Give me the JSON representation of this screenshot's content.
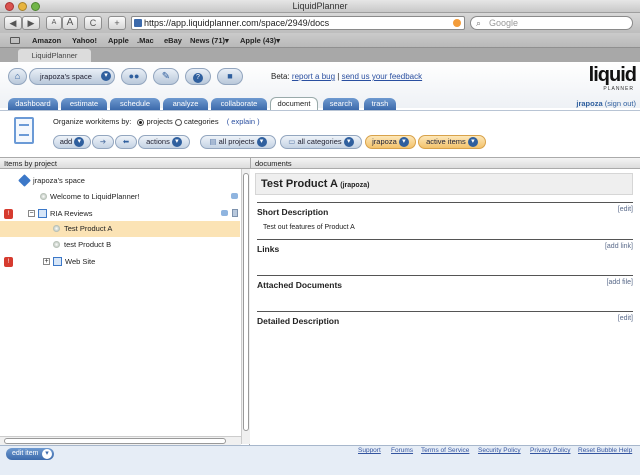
{
  "browser": {
    "window_title": "LiquidPlanner",
    "back_label": "◀",
    "forward_label": "▶",
    "text_smaller": "A",
    "text_larger": "A",
    "reload_label": "C",
    "add_label": "+",
    "url": "https://app.liquidplanner.com/space/2949/docs",
    "search_placeholder": "Google",
    "bookmarks": [
      "Amazon",
      "Yahoo!",
      "Apple",
      ".Mac",
      "eBay",
      "News (71)▾",
      "Apple (43)▾"
    ],
    "tab_title": "LiquidPlanner"
  },
  "app": {
    "space_label": "jrapoza's space",
    "beta_prefix": "Beta:",
    "report_bug": "report a bug",
    "separator": "|",
    "send_feedback": "send us your feedback",
    "logo_text": "liquid",
    "logo_sub": "PLANNER",
    "tabs": [
      "dashboard",
      "estimate",
      "schedule",
      "analyze",
      "collaborate",
      "document",
      "search",
      "trash"
    ],
    "active_tab": "document",
    "user": "jrapoza",
    "sign_out": "(sign out)",
    "help_label": "?"
  },
  "toolbar": {
    "organize_label": "Organize workitems by:",
    "opt_projects": "projects",
    "opt_categories": "categories",
    "explain": "( explain )",
    "add": "add",
    "actions": "actions",
    "all_projects": "all projects",
    "all_categories": "all categories",
    "user_filter": "jrapoza",
    "active_items": "active items"
  },
  "left": {
    "header": "Items by project",
    "items": [
      {
        "label": "jrapoza's space"
      },
      {
        "label": "Welcome to LiquidPlanner!"
      },
      {
        "label": "RIA Reviews"
      },
      {
        "label": "Test Product A"
      },
      {
        "label": "test Product B"
      },
      {
        "label": "Web Site"
      }
    ]
  },
  "right": {
    "header": "documents",
    "title": "Test Product A",
    "owner": "(jrapoza)",
    "sections": [
      {
        "title": "Short Description",
        "link": "[edit]",
        "body": "Test out features of Product A"
      },
      {
        "title": "Links",
        "link": "[add link]",
        "body": ""
      },
      {
        "title": "Attached Documents",
        "link": "[add file]",
        "body": ""
      },
      {
        "title": "Detailed Description",
        "link": "[edit]",
        "body": ""
      }
    ]
  },
  "footer": {
    "edit_item": "edit item",
    "links": [
      "Support",
      "Forums",
      "Terms of Service",
      "Security Policy",
      "Privacy Policy",
      "Reset Bubble Help"
    ]
  },
  "colors": {
    "accent": "#3c6aab",
    "selection": "#fbe3b5",
    "alert": "#d63b2f"
  }
}
